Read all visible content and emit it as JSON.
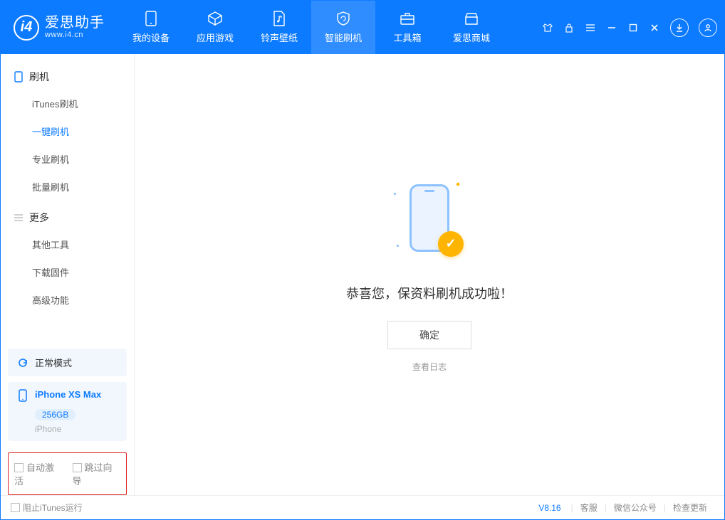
{
  "app": {
    "name": "爱思助手",
    "url": "www.i4.cn"
  },
  "tabs": {
    "device": "我的设备",
    "apps": "应用游戏",
    "ring": "铃声壁纸",
    "flash": "智能刷机",
    "tools": "工具箱",
    "store": "爱思商城"
  },
  "sidebar": {
    "section_flash": "刷机",
    "items_flash": {
      "itunes": "iTunes刷机",
      "oneclick": "一键刷机",
      "pro": "专业刷机",
      "batch": "批量刷机"
    },
    "section_more": "更多",
    "items_more": {
      "other": "其他工具",
      "firmware": "下载固件",
      "advanced": "高级功能"
    }
  },
  "mode_card": "正常模式",
  "device": {
    "name": "iPhone XS Max",
    "storage": "256GB",
    "type": "iPhone"
  },
  "options": {
    "auto_activate": "自动激活",
    "skip_guide": "跳过向导"
  },
  "main": {
    "success": "恭喜您，保资料刷机成功啦！",
    "ok": "确定",
    "viewlog": "查看日志"
  },
  "footer": {
    "block_itunes": "阻止iTunes运行",
    "version": "V8.16",
    "service": "客服",
    "wechat": "微信公众号",
    "update": "检查更新"
  }
}
